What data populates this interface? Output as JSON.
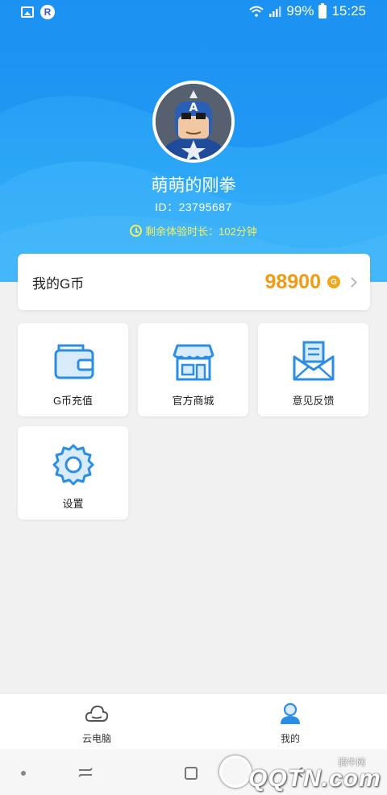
{
  "status_bar": {
    "battery": "99%",
    "time": "15:25",
    "r_icon_letter": "R"
  },
  "profile": {
    "name": "萌萌的刚拳",
    "id_text": "ID：23795687",
    "trial_text": "剩余体验时长：102分钟"
  },
  "coins": {
    "label": "我的G币",
    "value": "98900",
    "coin_letter": "G"
  },
  "tiles": [
    {
      "label": "G币充值",
      "icon": "wallet-icon"
    },
    {
      "label": "官方商城",
      "icon": "store-icon"
    },
    {
      "label": "意见反馈",
      "icon": "mail-icon"
    },
    {
      "label": "设置",
      "icon": "gear-icon"
    }
  ],
  "tabs": [
    {
      "label": "云电脑",
      "icon": "cloud-icon",
      "active": false
    },
    {
      "label": "我的",
      "icon": "user-icon",
      "active": true
    }
  ],
  "watermark": {
    "brand": "QQTN.com",
    "small": "腾牛网"
  },
  "colors": {
    "accent": "#1e96f2",
    "coin": "#f29a12",
    "trial": "#f7ef5b",
    "icon_blue": "#2a8ee6",
    "icon_fill": "#d7ebfb"
  }
}
